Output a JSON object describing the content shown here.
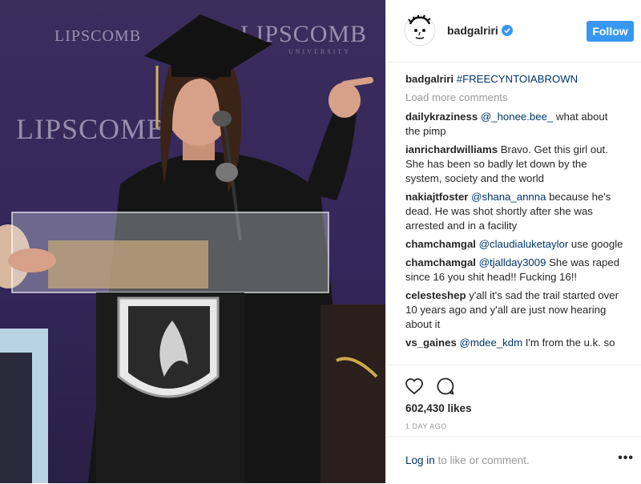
{
  "post": {
    "username": "badgalriri",
    "follow_label": "Follow",
    "caption_user": "badgalriri",
    "caption_text": "#FREECYNTOIABROWN",
    "load_more": "Load more comments",
    "likes": "602,430 likes",
    "date": "1 DAY AGO",
    "login_link": "Log in",
    "login_rest": " to like or comment.",
    "more_label": "•••"
  },
  "comments": [
    {
      "user": "dailykraziness",
      "mention": "@_honee.bee_",
      "text": " what about the pimp"
    },
    {
      "user": "ianrichardwilliams",
      "mention": "",
      "text": "Bravo. Get this girl out. She has been so badly let down by the system, society and the world"
    },
    {
      "user": "nakiajtfoster",
      "mention": "@shana_annna",
      "text": " because he's dead. He was shot shortly after she was arrested and in a facility"
    },
    {
      "user": "chamchamgal",
      "mention": "@claudialuketaylor",
      "text": " use google"
    },
    {
      "user": "chamchamgal",
      "mention": "@tjallday3009",
      "text": " She was raped since 16 you shit head!! Fucking 16!!"
    },
    {
      "user": "celesteshep",
      "mention": "",
      "text": "y'all it's sad the trail started over 10 years ago and y'all are just now hearing about it"
    },
    {
      "user": "vs_gaines",
      "mention": "@mdee_kdm",
      "text": " I'm from the u.k. so"
    }
  ],
  "photo": {
    "backdrop_text_1": "LIPSCOMB",
    "backdrop_text_2": "LIPSCOMB",
    "backdrop_text_3": "LIPSCOMB",
    "backdrop_sub": "UNIVERSITY"
  },
  "colors": {
    "accent": "#3897f0",
    "link": "#003569",
    "muted": "#999999",
    "backdrop": "#33265a"
  }
}
